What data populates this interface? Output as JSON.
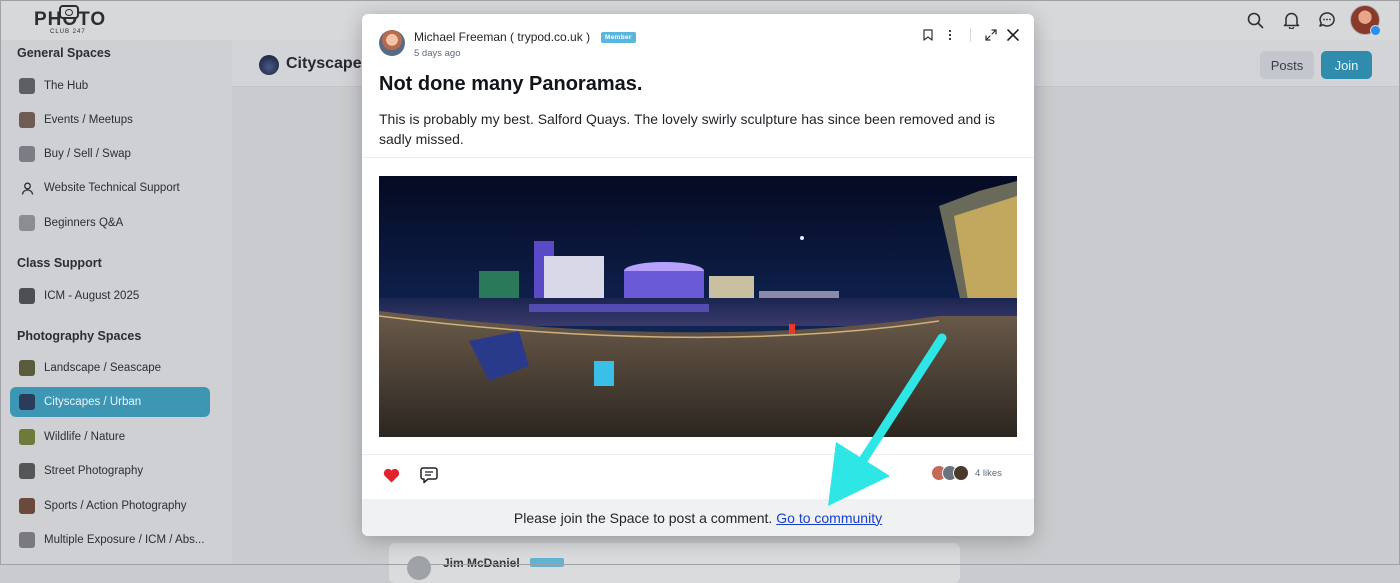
{
  "app": {
    "logo": {
      "main": "PHOTO",
      "sub": "CLUB 247"
    }
  },
  "topbar": {
    "icons": [
      "search-icon",
      "bell-icon",
      "chat-icon",
      "user-avatar"
    ]
  },
  "sidebar": {
    "sections": [
      {
        "title": "General Spaces",
        "items": [
          {
            "label": "The Hub",
            "thumb": "#5d5f63"
          },
          {
            "label": "Events / Meetups",
            "thumb": "#6e5b52"
          },
          {
            "label": "Buy / Sell / Swap",
            "thumb": "#7a7e84"
          },
          {
            "label": "Website Technical Support",
            "thumb": "person-icon"
          },
          {
            "label": "Beginners Q&A",
            "thumb": "#8a8d92"
          }
        ]
      },
      {
        "title": "Class Support",
        "items": [
          {
            "label": "ICM - August 2025",
            "thumb": "#4c4e52"
          }
        ]
      },
      {
        "title": "Photography Spaces",
        "items": [
          {
            "label": "Landscape / Seascape",
            "thumb": "#5a5a3c"
          },
          {
            "label": "Cityscapes / Urban",
            "thumb": "#2b3c5a",
            "active": true
          },
          {
            "label": "Wildlife / Nature",
            "thumb": "#6c7a3a"
          },
          {
            "label": "Street Photography",
            "thumb": "#555658"
          },
          {
            "label": "Sports / Action Photography",
            "thumb": "#6a4a3a"
          },
          {
            "label": "Multiple Exposure / ICM / Abs...",
            "thumb": "#7a7a7e"
          }
        ]
      }
    ]
  },
  "space": {
    "title": "Cityscapes",
    "posts_label": "Posts",
    "join_label": "Join"
  },
  "background_post": {
    "author": "Jim McDaniel"
  },
  "post": {
    "author": "Michael Freeman ( trypod.co.uk )",
    "badge": "Member",
    "time": "5 days ago",
    "title": "Not done many Panoramas.",
    "body": "This is probably my best. Salford Quays. The lovely swirly sculpture has since been removed and is sadly missed.",
    "likes_text": "4 likes",
    "liker_colors": [
      "#c46a5a",
      "#6a7480",
      "#4a3a2a"
    ],
    "footer_text": "Please join the Space to post a comment.",
    "footer_link": "Go to community"
  },
  "colors": {
    "accent": "#3d96b4",
    "heart": "#e0242f",
    "arrow": "#2ee6e6",
    "link": "#1a3fc9"
  }
}
